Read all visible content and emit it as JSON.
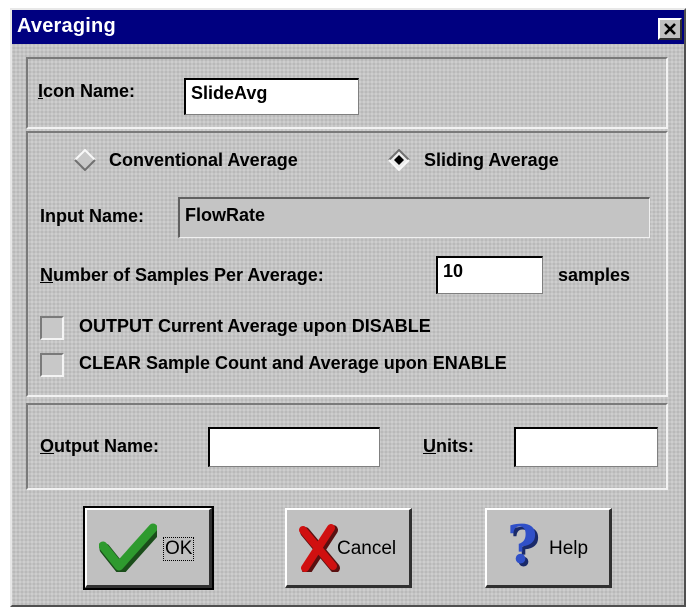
{
  "window": {
    "title": "Averaging"
  },
  "icon_name": {
    "label_underlined": "I",
    "label_rest": "con Name:",
    "value": "SlideAvg"
  },
  "averaging_mode": {
    "options": [
      {
        "label": "Conventional Average",
        "selected": false
      },
      {
        "label": "Sliding Average",
        "selected": true
      }
    ]
  },
  "input_name": {
    "label": "Input Name:",
    "value": "FlowRate"
  },
  "samples": {
    "label_underlined": "N",
    "label_rest": "umber of Samples Per Average:",
    "value": "10",
    "unit": "samples"
  },
  "options": {
    "output_on_disable": {
      "label": "OUTPUT Current Average upon DISABLE",
      "checked": false
    },
    "clear_on_enable": {
      "label": "CLEAR Sample Count and Average upon ENABLE",
      "checked": false
    }
  },
  "output": {
    "name_label_underlined": "O",
    "name_label_rest": "utput Name:",
    "name_value": "",
    "units_label_underlined": "U",
    "units_label_rest": "nits:",
    "units_value": ""
  },
  "buttons": {
    "ok": {
      "label": "OK",
      "icon": "checkmark-icon"
    },
    "cancel": {
      "label": "Cancel",
      "icon": "x-icon"
    },
    "help": {
      "label": "Help",
      "icon": "question-mark-icon"
    }
  },
  "colors": {
    "titlebar": "#000080",
    "dialog_face": "#c4c4c4",
    "ok_check": "#2e9a2e",
    "cancel_x": "#d01010",
    "help_q": "#3050c8"
  }
}
